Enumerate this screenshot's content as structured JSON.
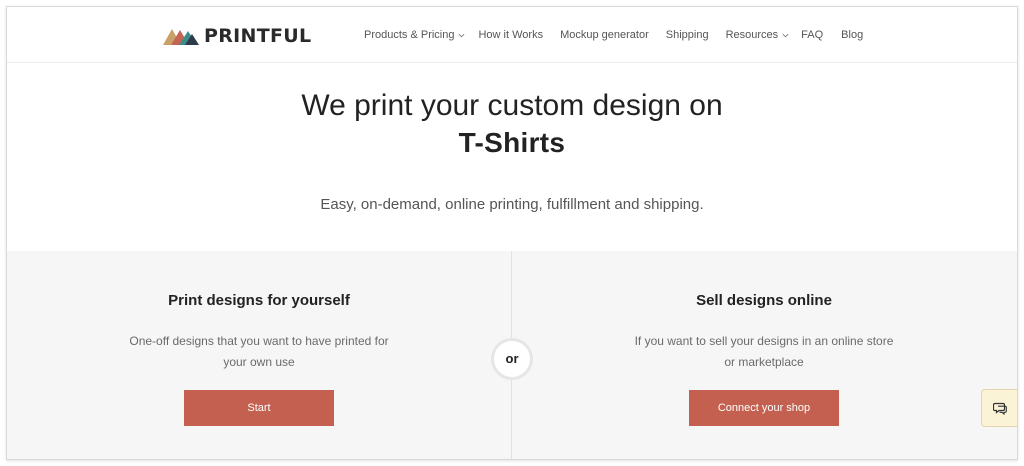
{
  "brand": {
    "name": "PRINTFUL",
    "logo_colors": [
      "#c9a06a",
      "#c46453",
      "#3f8a8b",
      "#2d3a4a"
    ]
  },
  "nav": {
    "items": [
      {
        "label": "Products & Pricing",
        "has_dropdown": true
      },
      {
        "label": "How it Works",
        "has_dropdown": false
      },
      {
        "label": "Mockup generator",
        "has_dropdown": false
      },
      {
        "label": "Shipping",
        "has_dropdown": false
      },
      {
        "label": "Resources",
        "has_dropdown": true
      },
      {
        "label": "FAQ",
        "has_dropdown": false
      },
      {
        "label": "Blog",
        "has_dropdown": false
      }
    ]
  },
  "hero": {
    "title": "We print your custom design on",
    "product": "T-Shirts",
    "subtitle": "Easy, on-demand, online printing, fulfillment and shipping."
  },
  "options": {
    "left": {
      "title": "Print designs for yourself",
      "description": "One-off designs that you want to have printed for your own use",
      "button": "Start"
    },
    "separator": "or",
    "right": {
      "title": "Sell designs online",
      "description": "If you want to sell your designs in an online store or marketplace",
      "button": "Connect your shop"
    }
  },
  "chat_widget": {
    "icon": "chat-icon"
  },
  "colors": {
    "accent": "#c4604f",
    "section_bg": "#f6f6f6",
    "chat_bg": "#fbf3d6"
  }
}
